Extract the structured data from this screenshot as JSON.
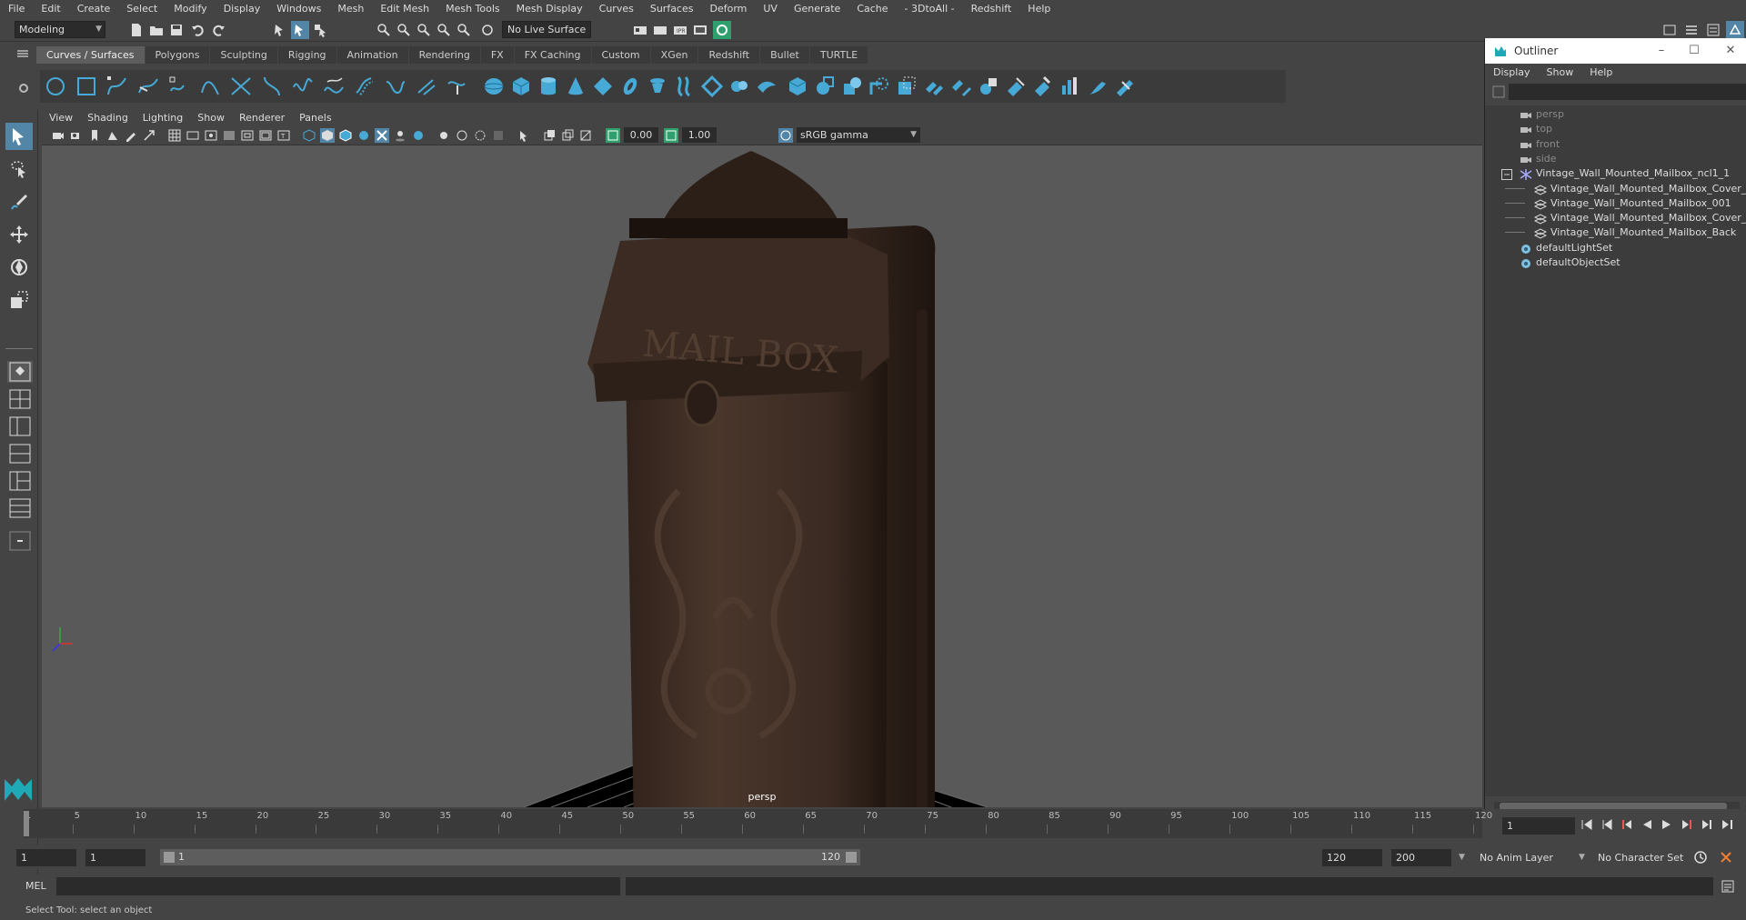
{
  "menubar": {
    "items": [
      "File",
      "Edit",
      "Create",
      "Select",
      "Modify",
      "Display",
      "Windows",
      "Mesh",
      "Edit Mesh",
      "Mesh Tools",
      "Mesh Display",
      "Curves",
      "Surfaces",
      "Deform",
      "UV",
      "Generate",
      "Cache",
      "- 3DtoAll -",
      "Redshift",
      "Help"
    ]
  },
  "statusline": {
    "mode": "Modeling",
    "live_surface": "No Live Surface"
  },
  "shelf": {
    "tabs": [
      "Curves / Surfaces",
      "Polygons",
      "Sculpting",
      "Rigging",
      "Animation",
      "Rendering",
      "FX",
      "FX Caching",
      "Custom",
      "XGen",
      "Redshift",
      "Bullet",
      "TURTLE"
    ],
    "active_tab": "Curves / Surfaces"
  },
  "panel": {
    "menu": [
      "View",
      "Shading",
      "Lighting",
      "Show",
      "Renderer",
      "Panels"
    ],
    "exposure": "0.00",
    "gamma": "1.00",
    "color_space": "sRGB gamma",
    "camera_label": "persp",
    "model_text": "MAIL BOX"
  },
  "outliner": {
    "title": "Outliner",
    "menu": [
      "Display",
      "Show",
      "Help"
    ],
    "items": [
      {
        "label": "persp",
        "type": "camera",
        "dim": true,
        "indent": 1
      },
      {
        "label": "top",
        "type": "camera",
        "dim": true,
        "indent": 1
      },
      {
        "label": "front",
        "type": "camera",
        "dim": true,
        "indent": 1
      },
      {
        "label": "side",
        "type": "camera",
        "dim": true,
        "indent": 1
      },
      {
        "label": "Vintage_Wall_Mounted_Mailbox_ncl1_1",
        "type": "group",
        "dim": false,
        "indent": 1
      },
      {
        "label": "Vintage_Wall_Mounted_Mailbox_Cover_",
        "type": "mesh",
        "dim": false,
        "indent": 2
      },
      {
        "label": "Vintage_Wall_Mounted_Mailbox_001",
        "type": "mesh",
        "dim": false,
        "indent": 2
      },
      {
        "label": "Vintage_Wall_Mounted_Mailbox_Cover_",
        "type": "mesh",
        "dim": false,
        "indent": 2
      },
      {
        "label": "Vintage_Wall_Mounted_Mailbox_Back",
        "type": "mesh",
        "dim": false,
        "indent": 2
      },
      {
        "label": "defaultLightSet",
        "type": "set",
        "dim": false,
        "indent": 1
      },
      {
        "label": "defaultObjectSet",
        "type": "set",
        "dim": false,
        "indent": 1
      }
    ]
  },
  "timeslider": {
    "start": 1,
    "end": 120,
    "ticks": [
      1,
      5,
      10,
      15,
      20,
      25,
      30,
      35,
      40,
      45,
      50,
      55,
      60,
      65,
      70,
      75,
      80,
      85,
      90,
      95,
      100,
      105,
      110,
      115,
      120
    ],
    "current_frame": "1"
  },
  "rangeslider": {
    "start_field": "1",
    "playback_start_field": "1",
    "range_start_label": "1",
    "range_end_label": "120",
    "playback_end_field": "120",
    "end_field": "200",
    "anim_layer": "No Anim Layer",
    "character_set": "No Character Set"
  },
  "cmdline": {
    "label": "MEL"
  },
  "helpline": {
    "text": "Select Tool: select an object"
  },
  "colors": {
    "accent_blue": "#5285a6",
    "shelf_icon_blue": "#46a9d6",
    "viewport_bg": "#595959"
  }
}
